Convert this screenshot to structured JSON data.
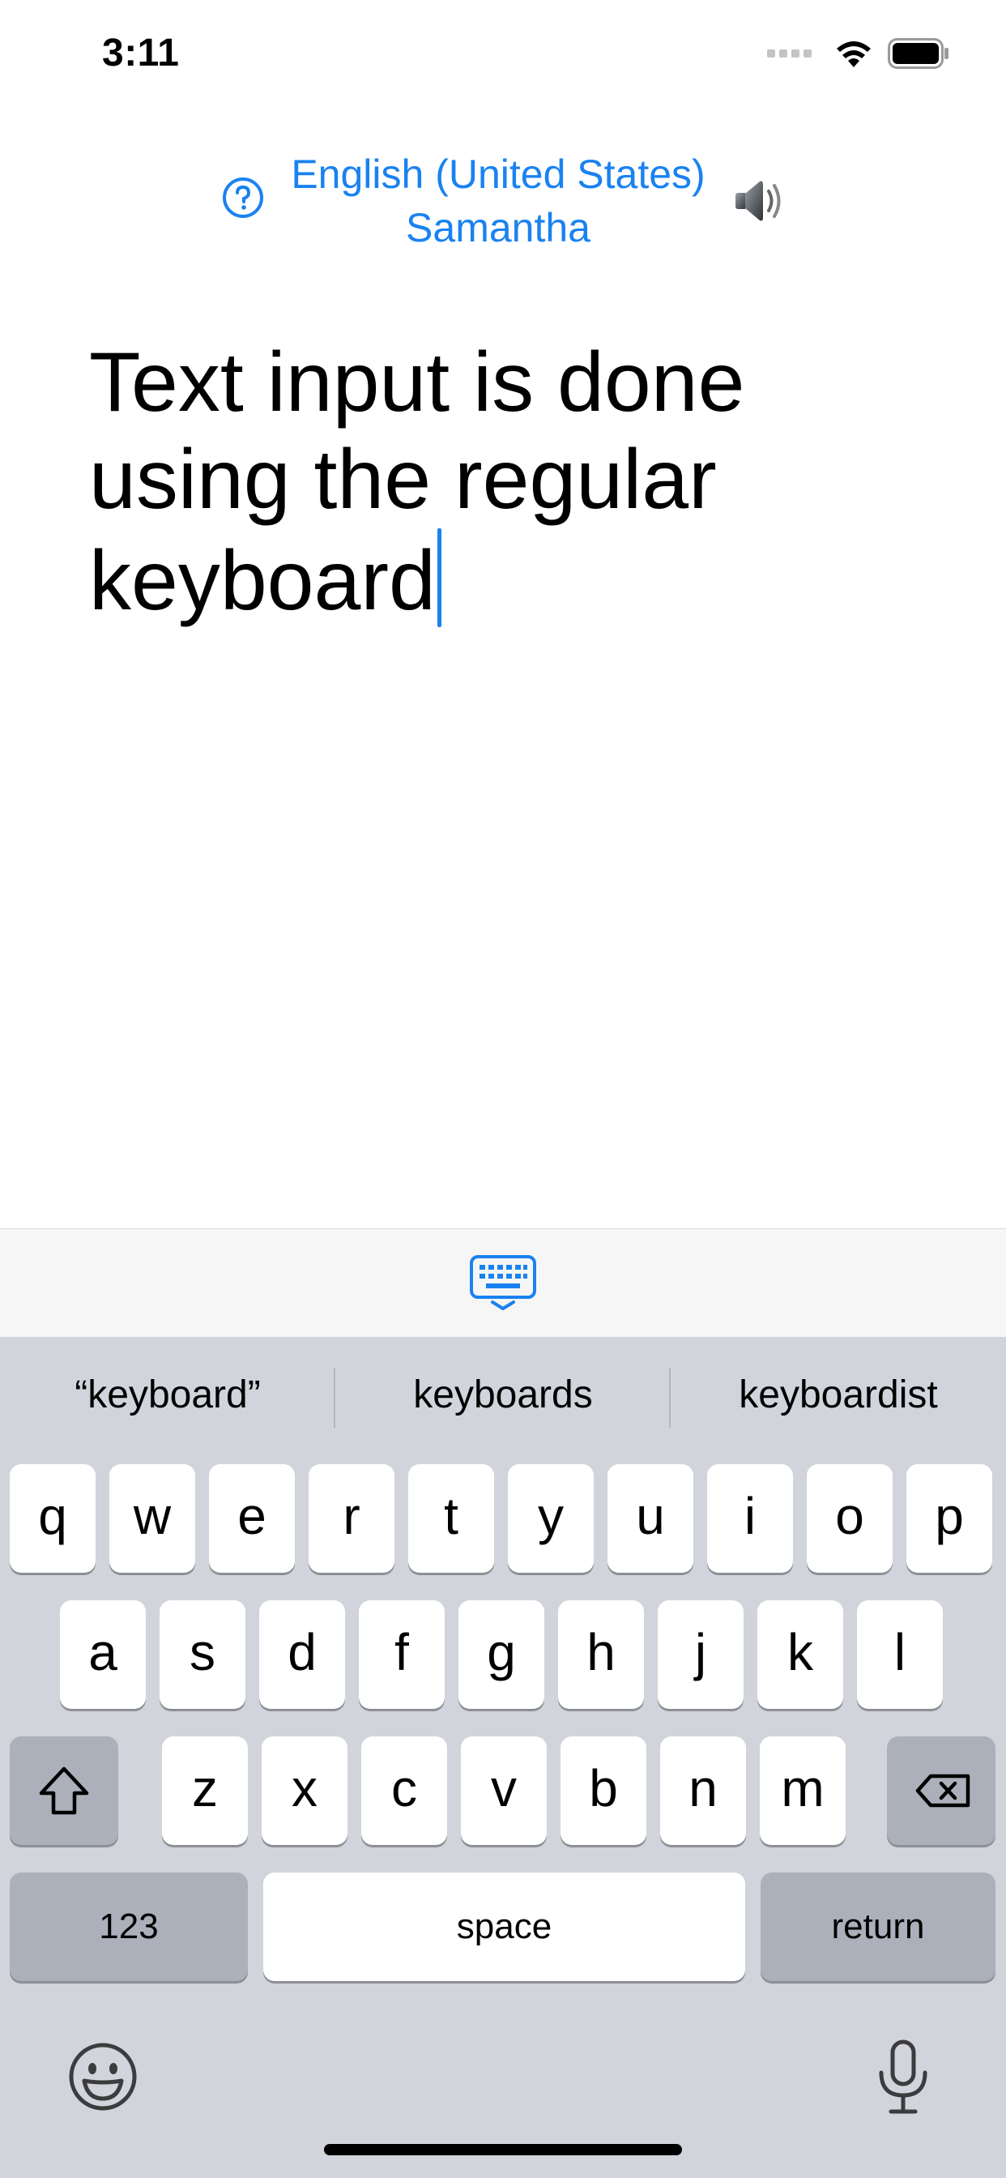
{
  "status_bar": {
    "time": "3:11"
  },
  "header": {
    "language": "English (United States)",
    "voice": "Samantha"
  },
  "editor": {
    "text": "Text input is done using the regular keyboard"
  },
  "keyboard": {
    "suggestions": [
      "“keyboard”",
      "keyboards",
      "keyboardist"
    ],
    "row1": [
      "q",
      "w",
      "e",
      "r",
      "t",
      "y",
      "u",
      "i",
      "o",
      "p"
    ],
    "row2": [
      "a",
      "s",
      "d",
      "f",
      "g",
      "h",
      "j",
      "k",
      "l"
    ],
    "row3": [
      "z",
      "x",
      "c",
      "v",
      "b",
      "n",
      "m"
    ],
    "numbers_label": "123",
    "space_label": "space",
    "return_label": "return"
  },
  "colors": {
    "accent": "#1a82f0",
    "keyboard_bg": "#d1d4db",
    "key_dark": "#abb0ba"
  }
}
